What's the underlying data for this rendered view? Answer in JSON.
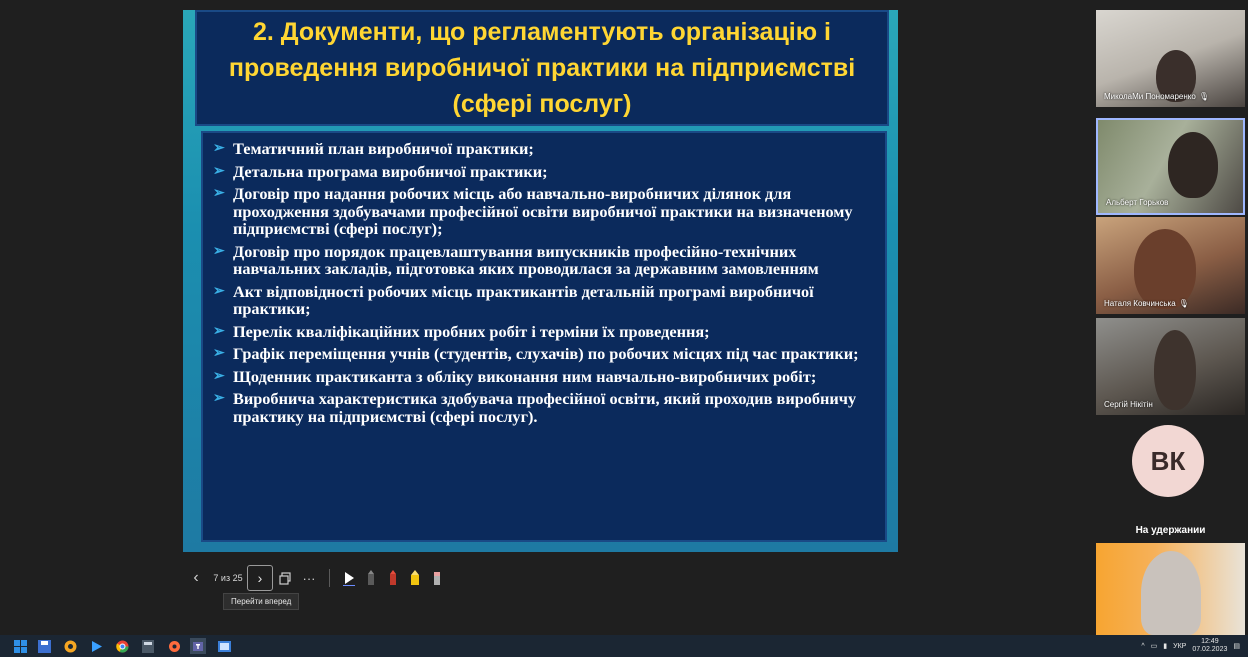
{
  "slide": {
    "title": "2. Документи, що регламентують організацію і проведення  виробничої практики на підприємстві (сфері послуг)",
    "bullets": [
      "Тематичний план виробничої практики;",
      "Детальна програма виробничої практики;",
      "Договір про надання робочих місць або навчально-виробничих ділянок для проходження здобувачами професійної освіти виробничої практики на визначеному підприємстві (сфері послуг);",
      "Договір про порядок працевлаштування випускників професійно-технічних навчальних закладів, підготовка яких проводилася за державним замовленням",
      "Акт відповідності робочих місць практикантів детальній програмі виробничої практики;",
      "Перелік кваліфікаційних пробних робіт і терміни їх проведення;",
      "Графік переміщення учнів (студентів, слухачів) по робочих місцях під час практики;",
      "Щоденник практиканта з обліку виконання ним навчально-виробничих робіт;",
      "Виробнича характеристика здобувача професійної освіти, який проходив виробничу практику на підприємстві (сфері послуг)."
    ],
    "bullet_glyph": "➢"
  },
  "participants": [
    {
      "name": "МиколаМи Пономаренко",
      "muted": true
    },
    {
      "name": "Альберт Горьков",
      "muted": false
    },
    {
      "name": "Наталя Ковчинська",
      "muted": true
    },
    {
      "name": "Сергій Нікітін",
      "muted": false
    }
  ],
  "on_hold": {
    "initials": "ВК",
    "label": "На удержании"
  },
  "toolbar": {
    "prev_icon": "‹",
    "page_count": "7 из 25",
    "next_icon": "›",
    "more_icon": "···",
    "tooltip": "Перейти вперед"
  },
  "tray": {
    "lang": "УКР",
    "time": "12:49",
    "date": "07.02.2023"
  },
  "colors": {
    "title_yellow": "#ffd633",
    "slide_navy": "#0b2a5c",
    "bullet_blue": "#3ab0e6",
    "taskbar": "#1b2633"
  }
}
